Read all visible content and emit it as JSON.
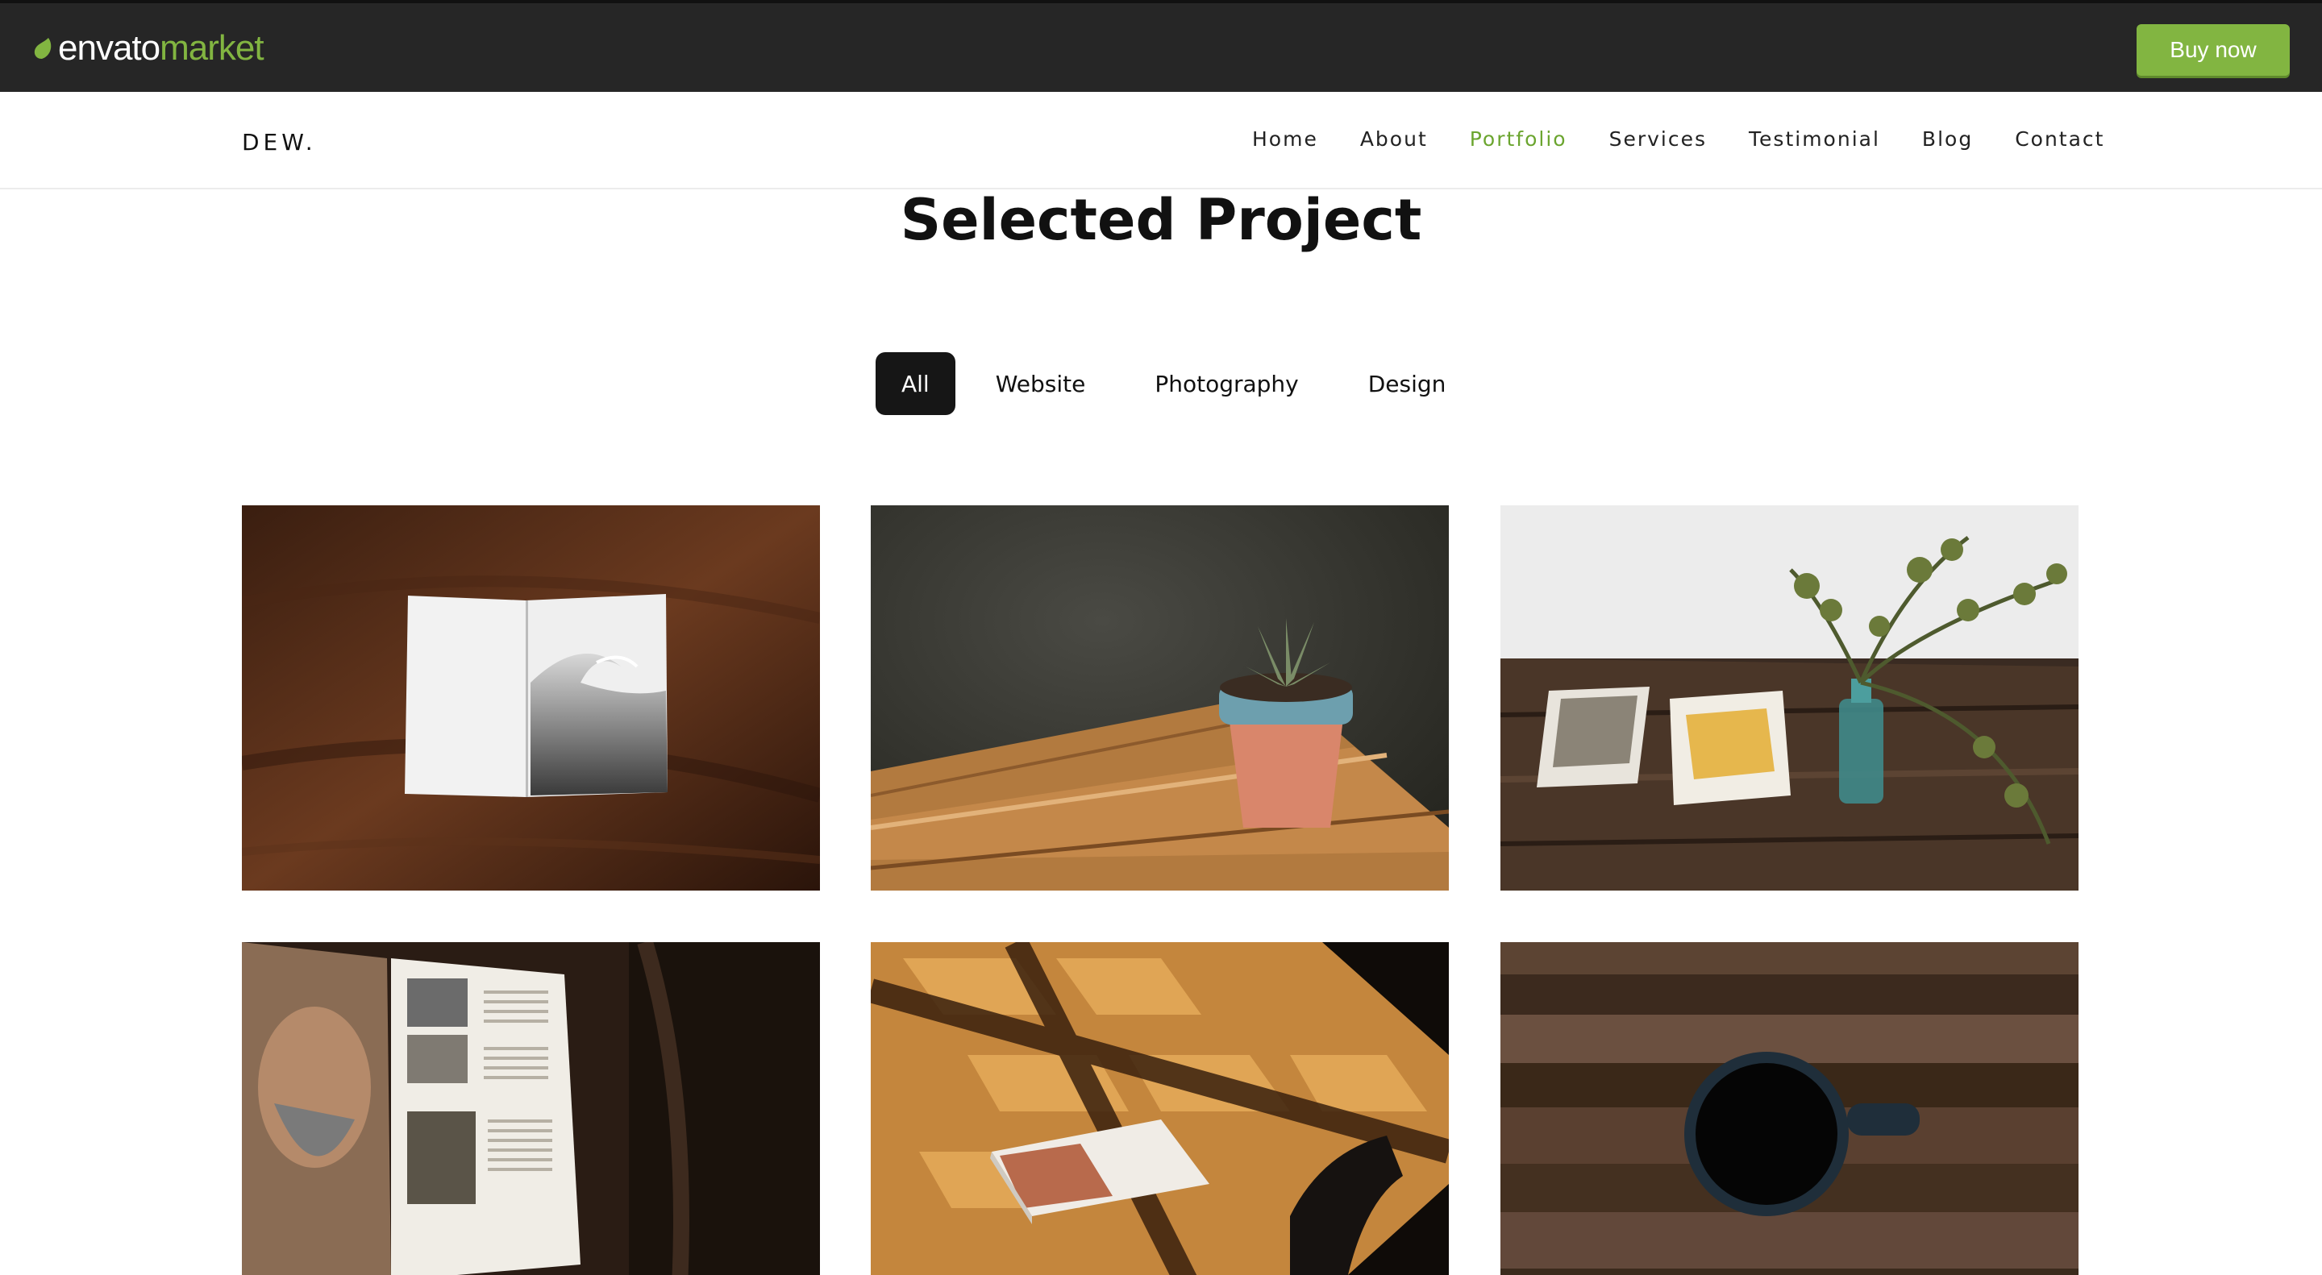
{
  "envato_bar": {
    "logo_primary": "envato",
    "logo_secondary": "market",
    "buy_label": "Buy now",
    "accent_color": "#82b541",
    "background_color": "#262626"
  },
  "header": {
    "brand": "DEW.",
    "nav": [
      {
        "label": "Home",
        "active": false
      },
      {
        "label": "About",
        "active": false
      },
      {
        "label": "Portfolio",
        "active": true
      },
      {
        "label": "Services",
        "active": false
      },
      {
        "label": "Testimonial",
        "active": false
      },
      {
        "label": "Blog",
        "active": false
      },
      {
        "label": "Contact",
        "active": false
      }
    ],
    "active_color": "#6ba52f"
  },
  "main": {
    "title": "Selected Project",
    "filters": [
      {
        "label": "All",
        "active": true
      },
      {
        "label": "Website",
        "active": false
      },
      {
        "label": "Photography",
        "active": false
      },
      {
        "label": "Design",
        "active": false
      }
    ]
  },
  "portfolio": {
    "items": [
      {
        "icon": "open-book-on-wooden-table-image"
      },
      {
        "icon": "potted-succulent-on-wooden-bench-image"
      },
      {
        "icon": "books-and-plant-vase-on-table-image"
      },
      {
        "icon": "open-magazine-photo-spread-image"
      },
      {
        "icon": "magazine-on-sunlit-table-image"
      },
      {
        "icon": "coffee-mug-on-wood-image"
      }
    ]
  }
}
